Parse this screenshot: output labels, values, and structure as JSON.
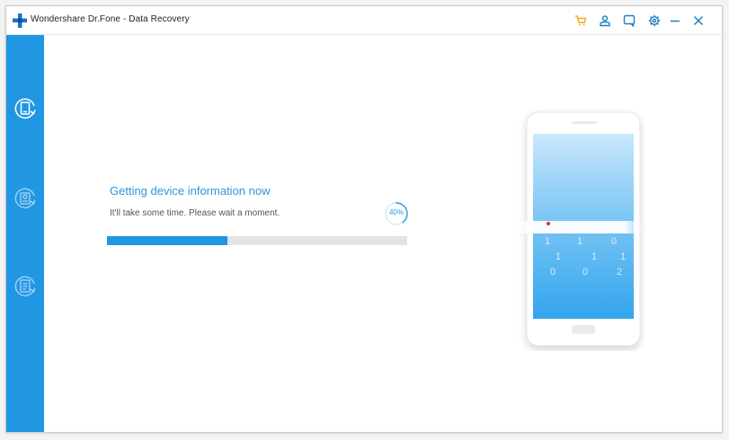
{
  "app": {
    "title": "Wondershare Dr.Fone - Data Recovery"
  },
  "titlebar_icons": [
    "cart-icon",
    "user-icon",
    "feedback-icon",
    "settings-icon",
    "minimize-icon",
    "close-icon"
  ],
  "sidebar": {
    "items": [
      {
        "name": "recover-from-device",
        "active": true
      },
      {
        "name": "recover-from-itunes-backup",
        "active": false
      },
      {
        "name": "recover-from-icloud-backup",
        "active": false
      }
    ]
  },
  "status": {
    "heading": "Getting device information now",
    "message": "It'll take some time. Please wait a moment.",
    "progress_label": "40%",
    "progress": 0.4
  },
  "phone_screen": {
    "digits": [
      "1",
      "1",
      "0",
      "1",
      "1",
      "1",
      "0",
      "0",
      "2"
    ]
  },
  "colors": {
    "accent": "#2196e3",
    "progress_fill": "#1e98e2",
    "progress_track": "#e3e3e3",
    "cart_icon": "#f5a623",
    "scan_dot": "#e8242f"
  }
}
